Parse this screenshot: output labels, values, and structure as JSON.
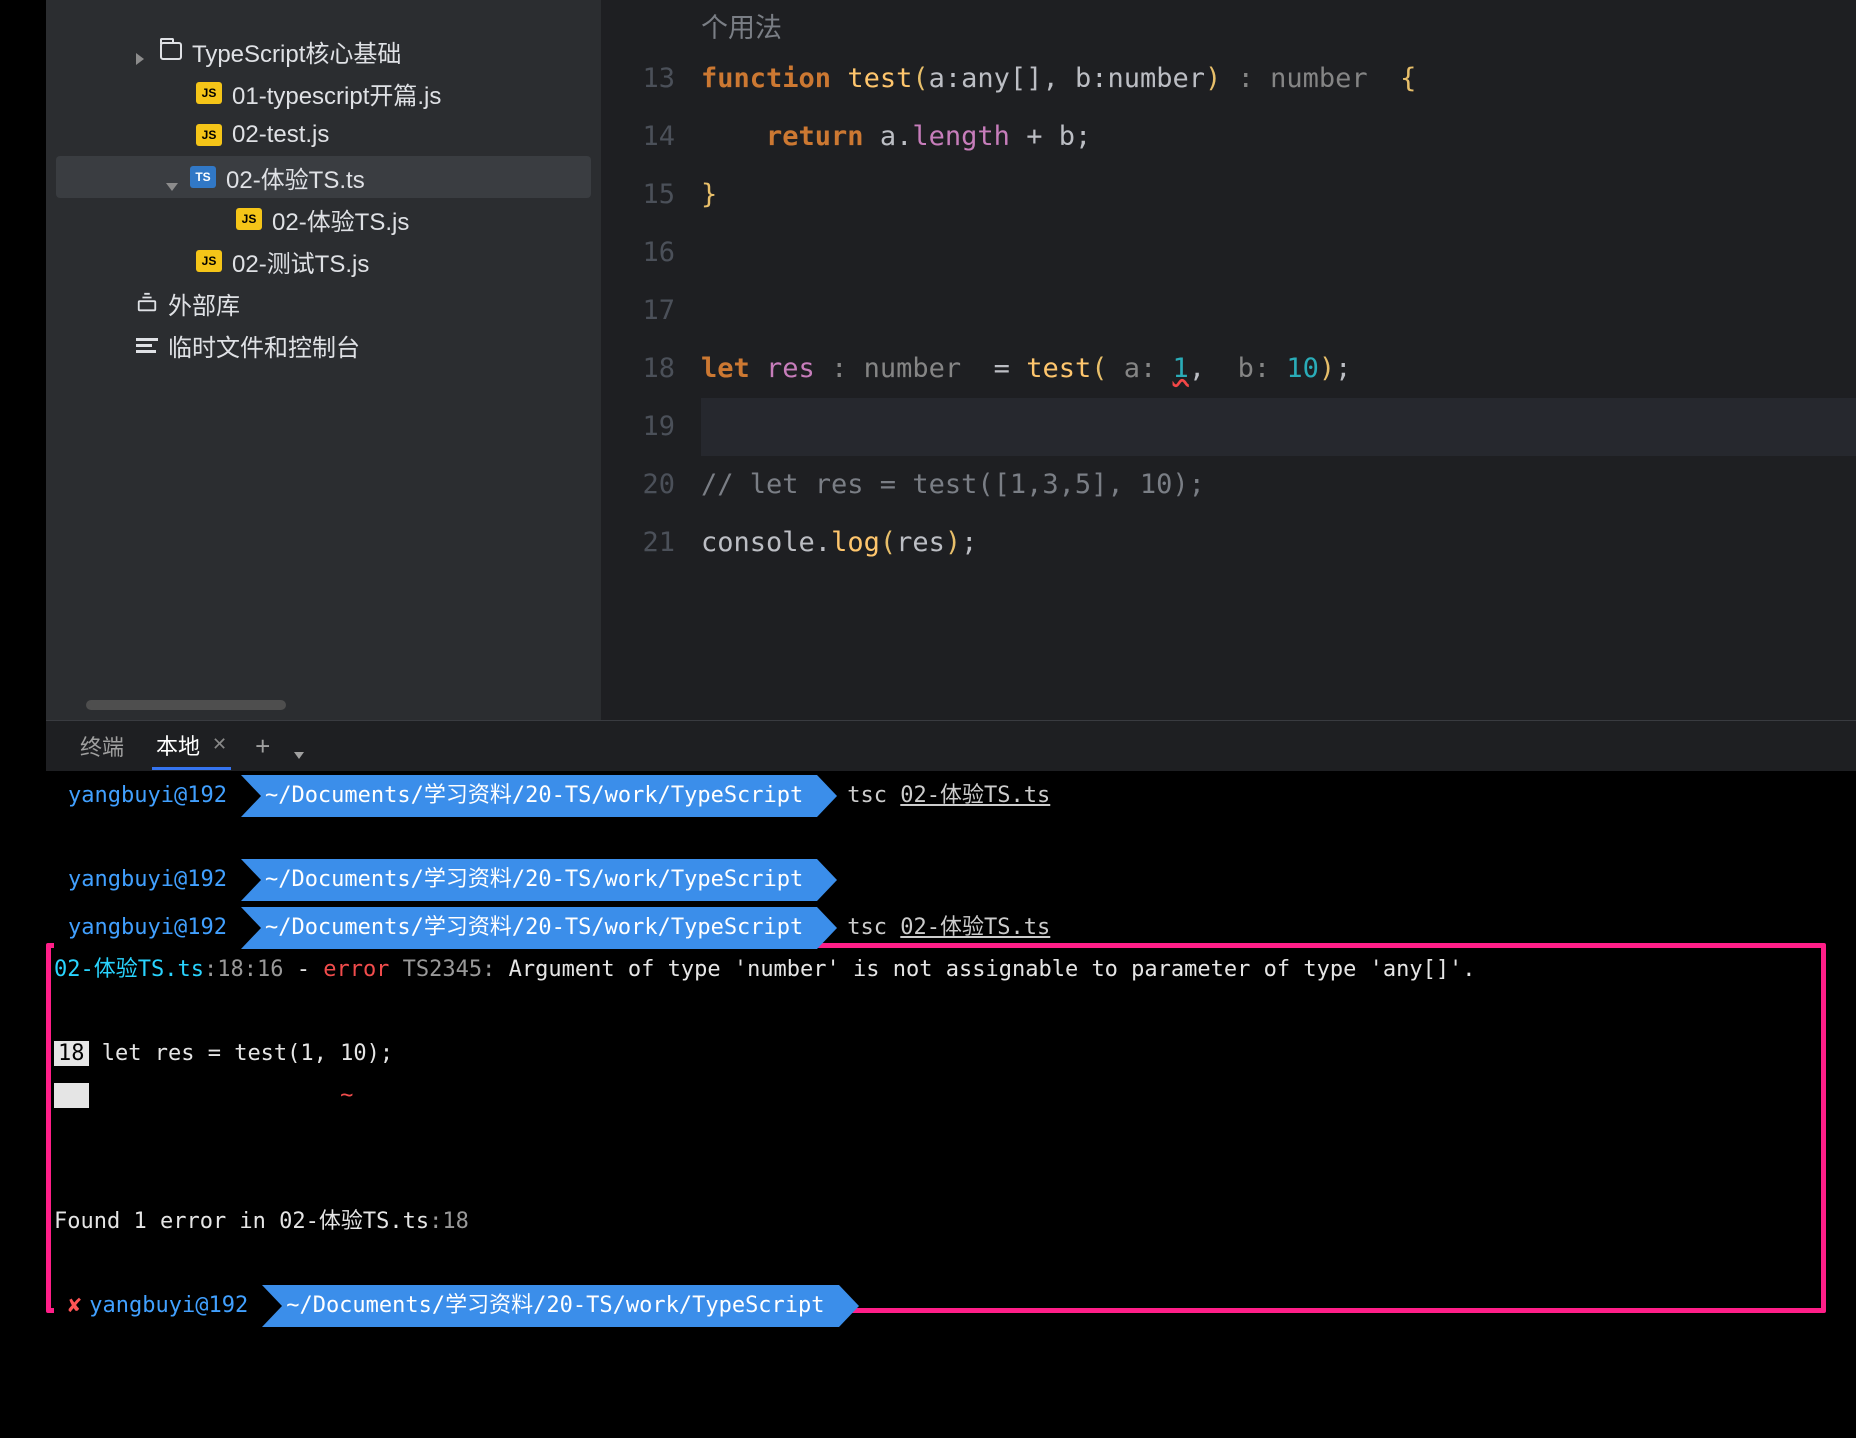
{
  "sidebar": {
    "items": [
      {
        "kind": "folder",
        "chevron": "right",
        "label": "TypeScript核心基础"
      },
      {
        "kind": "js",
        "label": "01-typescript开篇.js"
      },
      {
        "kind": "js",
        "label": "02-test.js"
      },
      {
        "kind": "ts",
        "chevron": "down",
        "label": "02-体验TS.ts",
        "selected": true
      },
      {
        "kind": "js",
        "child": true,
        "label": "02-体验TS.js"
      },
      {
        "kind": "js",
        "label": "02-测试TS.js"
      },
      {
        "kind": "lib",
        "label": "外部库"
      },
      {
        "kind": "scratch",
        "label": "临时文件和控制台"
      }
    ]
  },
  "editor": {
    "lines": [
      13,
      14,
      15,
      16,
      17,
      18,
      19,
      20,
      21
    ],
    "line13_kw_function": "function",
    "line13_fn": "test",
    "line13_a": "a",
    "line13_any": "any",
    "line13_b": "b",
    "line13_number": "number",
    "line14_return": "return",
    "line14_a": "a",
    "line14_length": "length",
    "line14_b": "b",
    "line18_let": "let",
    "line18_res": "res",
    "line18_number": "number",
    "line18_test": "test",
    "line18_ahint": "a:",
    "line18_aval": "1",
    "line18_bhint": "b:",
    "line18_bval": "10",
    "line20": "// let res = test([1,3,5], 10);",
    "line21_console": "console",
    "line21_log": "log",
    "line21_res": "res",
    "partial_top": "个用法"
  },
  "terminal": {
    "tab_main": "终端",
    "tab_local": "本地",
    "prompt_user": "yangbuyi@192",
    "prompt_path": "~/Documents/学习资料/20-TS/work/TypeScript",
    "cmd_tsc": "tsc",
    "cmd_file": "02-体验TS.ts",
    "err_file": "02-体验TS.ts",
    "err_loc": ":18:16",
    "err_dash": " - ",
    "err_word": "error",
    "err_code": " TS2345: ",
    "err_msg": "Argument of type 'number' is not assignable to parameter of type 'any[]'.",
    "err_line_num": "18",
    "err_line_code": " let res = test(1, 10);",
    "err_caret": "                   ~",
    "found": "Found 1 error in 02-体验TS.ts",
    "found_loc": ":18"
  }
}
